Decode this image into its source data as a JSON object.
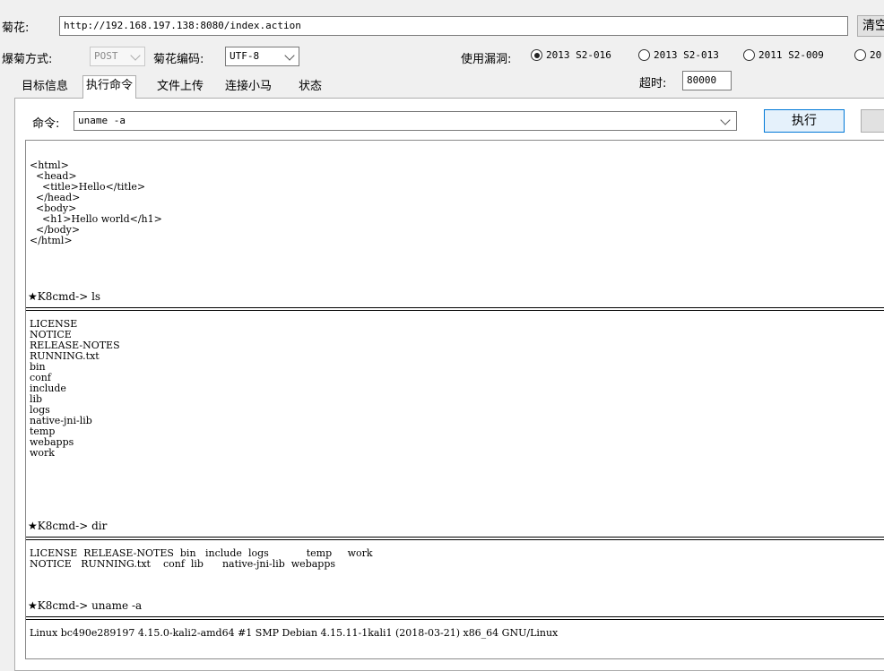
{
  "url_row": {
    "label": "菊花:",
    "url_value": "http://192.168.197.138:8080/index.action",
    "clear_button": "清空"
  },
  "options_row": {
    "method_label": "爆菊方式:",
    "method_value": "POST",
    "encoding_label": "菊花编码:",
    "encoding_value": "UTF-8",
    "vuln_label": "使用漏洞:",
    "vulns": [
      {
        "label": "2013 S2-016",
        "selected": true
      },
      {
        "label": "2013 S2-013",
        "selected": false
      },
      {
        "label": "2011  S2-009",
        "selected": false
      },
      {
        "label": "20",
        "selected": false
      }
    ],
    "timeout_label": "超时:",
    "timeout_value": "80000"
  },
  "tabs": [
    {
      "label": "目标信息",
      "active": false
    },
    {
      "label": "执行命令",
      "active": true
    },
    {
      "label": "文件上传",
      "active": false
    },
    {
      "label": "连接小马",
      "active": false
    },
    {
      "label": "状态",
      "active": false
    }
  ],
  "command": {
    "label": "命令:",
    "value": "uname -a",
    "execute_button": "执行"
  },
  "output": {
    "html_response": "<html>\n  <head>\n    <title>Hello</title>\n  </head>\n  <body>\n    <h1>Hello world</h1>\n  </body>\n</html>",
    "commands": [
      {
        "prompt": "★K8cmd-> ls",
        "result": "LICENSE\nNOTICE\nRELEASE-NOTES\nRUNNING.txt\nbin\nconf\ninclude\nlib\nlogs\nnative-jni-lib\ntemp\nwebapps\nwork"
      },
      {
        "prompt": "★K8cmd-> dir",
        "result": "LICENSE  RELEASE-NOTES  bin   include  logs            temp     work\nNOTICE   RUNNING.txt    conf  lib      native-jni-lib  webapps"
      },
      {
        "prompt": "★K8cmd-> uname -a",
        "result": "Linux bc490e289197 4.15.0-kali2-amd64 #1 SMP Debian 4.15.11-1kali1 (2018-03-21) x86_64 GNU/Linux"
      }
    ]
  }
}
